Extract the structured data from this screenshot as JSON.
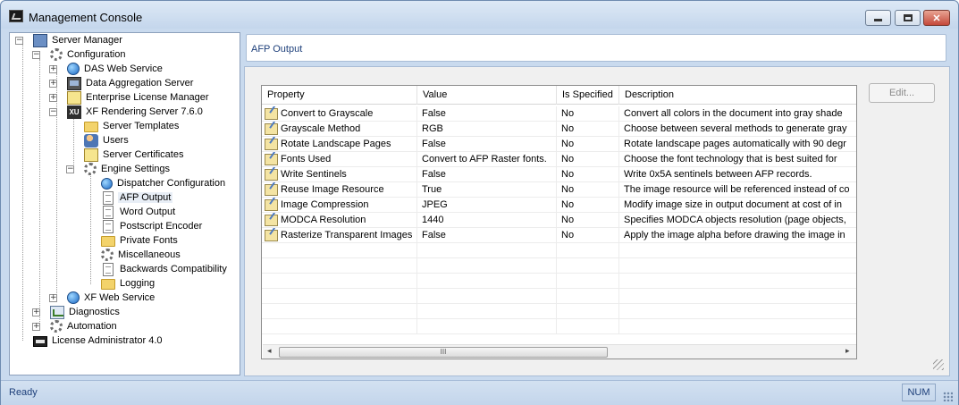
{
  "window": {
    "title": "Management Console",
    "min_icon": "minimize-icon",
    "max_icon": "maximize-icon",
    "close_icon": "close-icon",
    "close_glyph": "✕"
  },
  "tree": {
    "items": [
      {
        "label": "Server Manager",
        "icon": "server-manager-icon",
        "level": 0,
        "expanded": true
      },
      {
        "label": "Configuration",
        "icon": "gear-icon",
        "level": 1,
        "expanded": true
      },
      {
        "label": "DAS Web Service",
        "icon": "globe-icon",
        "level": 2,
        "expanded": false
      },
      {
        "label": "Data Aggregation Server",
        "icon": "das-icon",
        "level": 2,
        "expanded": false
      },
      {
        "label": "Enterprise License Manager",
        "icon": "license-icon",
        "level": 2,
        "expanded": false
      },
      {
        "label": "XF Rendering Server 7.6.0",
        "icon": "xu-icon",
        "level": 2,
        "expanded": true
      },
      {
        "label": "Server Templates",
        "icon": "folder-icon",
        "level": 3
      },
      {
        "label": "Users",
        "icon": "users-icon",
        "level": 3
      },
      {
        "label": "Server Certificates",
        "icon": "certificate-icon",
        "level": 3
      },
      {
        "label": "Engine Settings",
        "icon": "gear-icon",
        "level": 3,
        "expanded": true
      },
      {
        "label": "Dispatcher Configuration",
        "icon": "dispatcher-icon",
        "level": 4
      },
      {
        "label": "AFP Output",
        "icon": "document-icon",
        "level": 4,
        "selected": true
      },
      {
        "label": "Word Output",
        "icon": "document-icon",
        "level": 4
      },
      {
        "label": "Postscript Encoder",
        "icon": "document-icon",
        "level": 4
      },
      {
        "label": "Private Fonts",
        "icon": "folder-icon",
        "level": 4
      },
      {
        "label": "Miscellaneous",
        "icon": "gear-icon",
        "level": 4
      },
      {
        "label": "Backwards Compatibility",
        "icon": "document-icon",
        "level": 4
      },
      {
        "label": "Logging",
        "icon": "folder-icon",
        "level": 4
      },
      {
        "label": "XF Web Service",
        "icon": "globe-icon",
        "level": 2,
        "expanded": false
      },
      {
        "label": "Diagnostics",
        "icon": "chart-icon",
        "level": 1,
        "expanded": false
      },
      {
        "label": "Automation",
        "icon": "computer-icon",
        "level": 1,
        "expanded": false
      },
      {
        "label": "License Administrator 4.0",
        "icon": "license-admin-icon",
        "level": 0
      }
    ]
  },
  "panel": {
    "title": "AFP Output",
    "edit_label": "Edit..."
  },
  "grid": {
    "columns": [
      "Property",
      "Value",
      "Is Specified",
      "Description"
    ],
    "rows": [
      {
        "property": "Convert to Grayscale",
        "value": "False",
        "specified": "No",
        "description": "Convert all colors in the document into gray shade"
      },
      {
        "property": "Grayscale Method",
        "value": "RGB",
        "specified": "No",
        "description": "Choose between several methods to generate gray"
      },
      {
        "property": "Rotate Landscape Pages",
        "value": "False",
        "specified": "No",
        "description": "Rotate landscape pages automatically with 90 degr"
      },
      {
        "property": "Fonts Used",
        "value": "Convert to AFP Raster fonts.",
        "specified": "No",
        "description": "Choose the font technology that is best suited for"
      },
      {
        "property": "Write Sentinels",
        "value": "False",
        "specified": "No",
        "description": "Write 0x5A sentinels between AFP records."
      },
      {
        "property": "Reuse Image Resource",
        "value": "True",
        "specified": "No",
        "description": "The image resource will be referenced instead of co"
      },
      {
        "property": "Image Compression",
        "value": "JPEG",
        "specified": "No",
        "description": "Modify image size in output document at cost of in"
      },
      {
        "property": "MODCA Resolution",
        "value": "1440",
        "specified": "No",
        "description": "Specifies MODCA objects resolution (page objects,"
      },
      {
        "property": "Rasterize Transparent Images",
        "value": "False",
        "specified": "No",
        "description": "Apply the image alpha before drawing the image in"
      }
    ],
    "scroll_left": "◂",
    "scroll_right": "▸",
    "scroll_thumb": "III"
  },
  "status": {
    "text": "Ready",
    "num": "NUM"
  }
}
